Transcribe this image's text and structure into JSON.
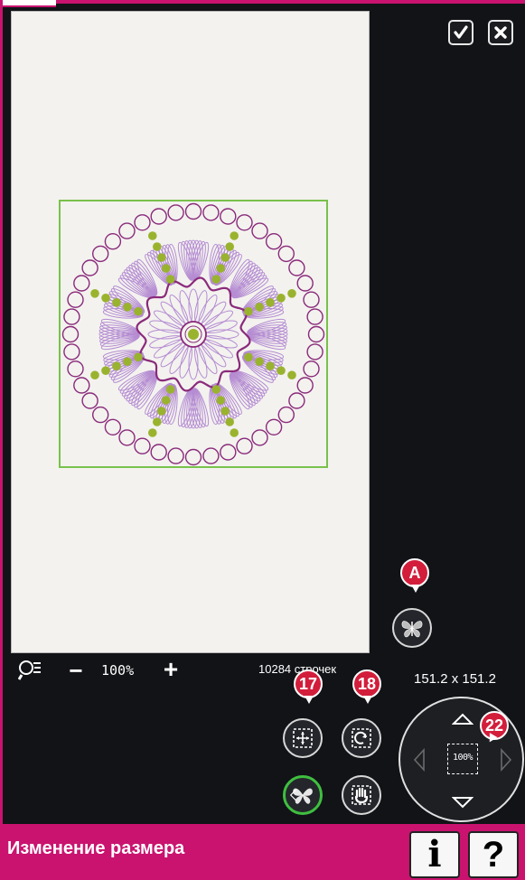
{
  "toolbar": {
    "ok_icon": "checkmark-icon",
    "cancel_icon": "close-icon"
  },
  "zoom": {
    "minus_label": "−",
    "level": "100%",
    "plus_label": "+",
    "stitch_count": "10284 строчек"
  },
  "callouts": {
    "a": "A",
    "c17": "17",
    "c18": "18",
    "c22": "22"
  },
  "size_readout": "151.2 x 151.2",
  "wheel": {
    "center_label": "100%"
  },
  "bottom_bar": {
    "title": "Изменение размера",
    "info_label": "i",
    "help_label": "?"
  },
  "colors": {
    "accent": "#c9136f",
    "hoop": "#79c14b",
    "design_purple": "#8a2a7a",
    "design_lilac": "#b58cd2",
    "design_green": "#9ab32e",
    "callout": "#d21e3b",
    "selected_ring": "#3fbf3f"
  }
}
